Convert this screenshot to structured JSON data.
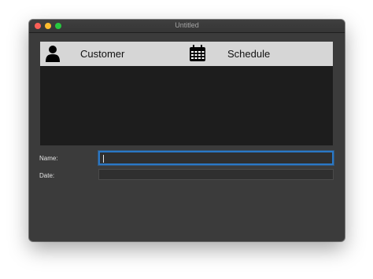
{
  "window": {
    "title": "Untitled"
  },
  "tabs": [
    {
      "label": "Customer",
      "icon": "person-icon"
    },
    {
      "label": "Schedule",
      "icon": "calendar-icon"
    }
  ],
  "form": {
    "name_label": "Name:",
    "name_value": "",
    "date_label": "Date:",
    "date_value": ""
  },
  "colors": {
    "tab_bar": "#d6d6d6",
    "content_pane": "#1d1d1d",
    "window_bg": "#3b3b3b",
    "focus_ring": "#2a78c6"
  }
}
